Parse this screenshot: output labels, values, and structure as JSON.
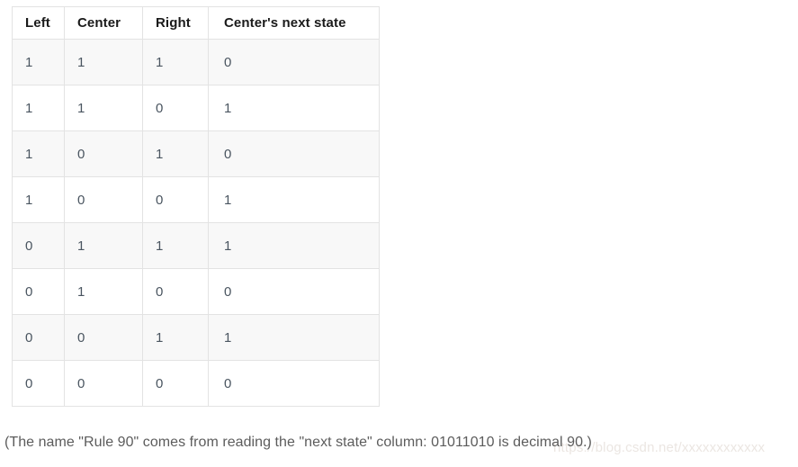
{
  "table": {
    "name": "rule-90-truth-table",
    "headers": [
      "Left",
      "Center",
      "Right",
      "Center's next state"
    ],
    "rows": [
      {
        "left": "1",
        "center": "1",
        "right": "1",
        "next": "0"
      },
      {
        "left": "1",
        "center": "1",
        "right": "0",
        "next": "1"
      },
      {
        "left": "1",
        "center": "0",
        "right": "1",
        "next": "0"
      },
      {
        "left": "1",
        "center": "0",
        "right": "0",
        "next": "1"
      },
      {
        "left": "0",
        "center": "1",
        "right": "1",
        "next": "1"
      },
      {
        "left": "0",
        "center": "1",
        "right": "0",
        "next": "0"
      },
      {
        "left": "0",
        "center": "0",
        "right": "1",
        "next": "1"
      },
      {
        "left": "0",
        "center": "0",
        "right": "0",
        "next": "0"
      }
    ]
  },
  "caption": {
    "text": "(The name \"Rule 90\" comes from reading the \"next state\" column: 01011010 is decimal 90.)"
  },
  "watermark": {
    "text": "https://blog.csdn.net/xxxxxxxxxxxx"
  },
  "colors": {
    "border": "#e3e3e3",
    "stripe_bg": "#f8f8f8",
    "row_bg": "#ffffff",
    "header_text": "#1a1a1a",
    "cell_text": "#4a5560",
    "caption_text": "#5c5c5c",
    "watermark_text": "#ebe6e2"
  }
}
